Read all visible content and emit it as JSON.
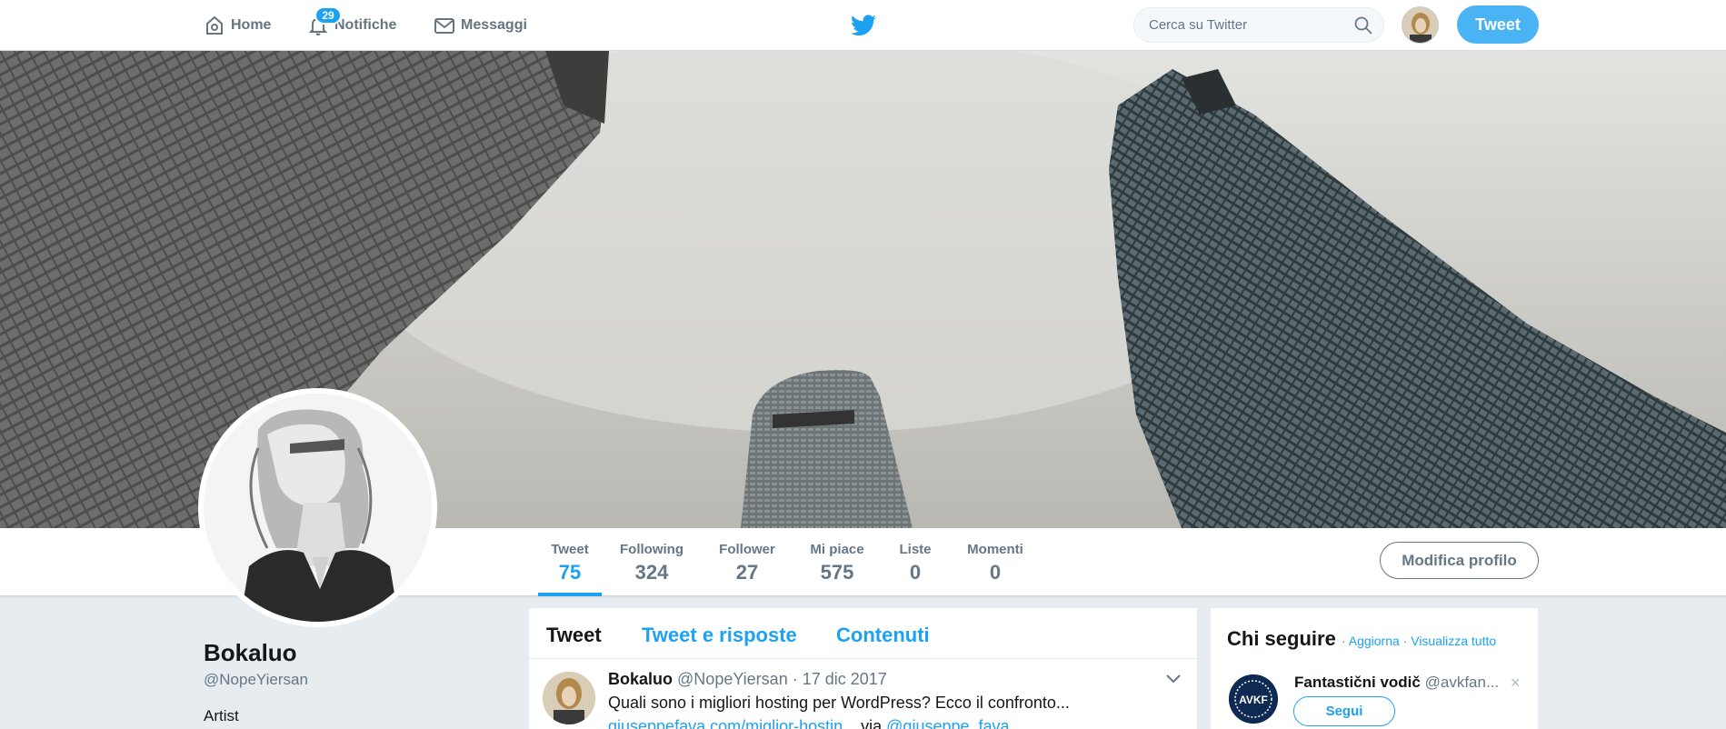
{
  "topnav": {
    "home_label": "Home",
    "notifications_label": "Notifiche",
    "notifications_badge": "29",
    "messages_label": "Messaggi",
    "search_placeholder": "Cerca su Twitter",
    "tweet_button": "Tweet"
  },
  "profile_nav": {
    "stats": [
      {
        "label": "Tweet",
        "value": "75"
      },
      {
        "label": "Following",
        "value": "324"
      },
      {
        "label": "Follower",
        "value": "27"
      },
      {
        "label": "Mi piace",
        "value": "575"
      },
      {
        "label": "Liste",
        "value": "0"
      },
      {
        "label": "Momenti",
        "value": "0"
      }
    ],
    "edit_button": "Modifica profilo"
  },
  "profile": {
    "name": "Bokaluo",
    "handle": "@NopeYiersan",
    "bio": "Artist"
  },
  "timeline": {
    "tabs": [
      "Tweet",
      "Tweet e risposte",
      "Contenuti"
    ],
    "tweet": {
      "name": "Bokaluo",
      "handle_date": "@NopeYiersan · 17 dic 2017",
      "text": "Quali sono i migliori hosting per WordPress? Ecco il confronto...",
      "link": "giuseppefava.com/miglior-hostin...",
      "via": " via ",
      "mention": "@giuseppe_fava"
    }
  },
  "who_to_follow": {
    "title": "Chi seguire",
    "refresh": "Aggiorna",
    "view_all": "Visualizza tutto",
    "separator": "·",
    "suggestion": {
      "name": "Fantastični vodič",
      "handle": "@avkfan...",
      "avatar_text": "AVKF",
      "follow_button": "Segui",
      "dismiss": "×"
    }
  },
  "colors": {
    "accent": "#1da1f2",
    "tweet_button": "#4ab3f4",
    "muted": "#657786",
    "background": "#e6ecf0"
  }
}
